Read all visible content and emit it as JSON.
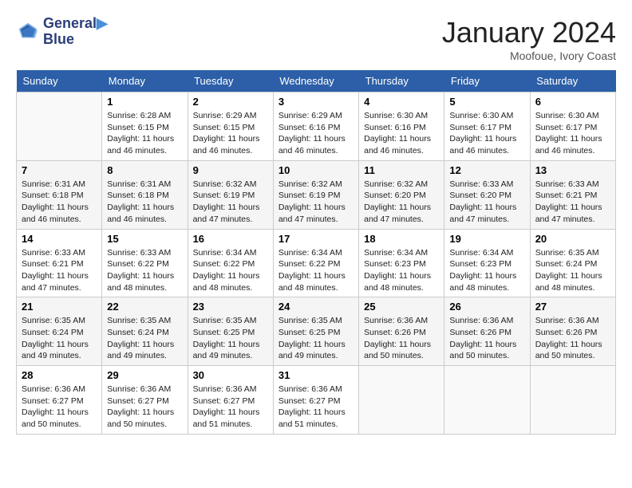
{
  "header": {
    "logo_line1": "General",
    "logo_line2": "Blue",
    "month_title": "January 2024",
    "subtitle": "Moofoue, Ivory Coast"
  },
  "weekdays": [
    "Sunday",
    "Monday",
    "Tuesday",
    "Wednesday",
    "Thursday",
    "Friday",
    "Saturday"
  ],
  "weeks": [
    [
      {
        "day": "",
        "sunrise": "",
        "sunset": "",
        "daylight": ""
      },
      {
        "day": "1",
        "sunrise": "6:28 AM",
        "sunset": "6:15 PM",
        "daylight": "11 hours and 46 minutes."
      },
      {
        "day": "2",
        "sunrise": "6:29 AM",
        "sunset": "6:15 PM",
        "daylight": "11 hours and 46 minutes."
      },
      {
        "day": "3",
        "sunrise": "6:29 AM",
        "sunset": "6:16 PM",
        "daylight": "11 hours and 46 minutes."
      },
      {
        "day": "4",
        "sunrise": "6:30 AM",
        "sunset": "6:16 PM",
        "daylight": "11 hours and 46 minutes."
      },
      {
        "day": "5",
        "sunrise": "6:30 AM",
        "sunset": "6:17 PM",
        "daylight": "11 hours and 46 minutes."
      },
      {
        "day": "6",
        "sunrise": "6:30 AM",
        "sunset": "6:17 PM",
        "daylight": "11 hours and 46 minutes."
      }
    ],
    [
      {
        "day": "7",
        "sunrise": "6:31 AM",
        "sunset": "6:18 PM",
        "daylight": "11 hours and 46 minutes."
      },
      {
        "day": "8",
        "sunrise": "6:31 AM",
        "sunset": "6:18 PM",
        "daylight": "11 hours and 46 minutes."
      },
      {
        "day": "9",
        "sunrise": "6:32 AM",
        "sunset": "6:19 PM",
        "daylight": "11 hours and 47 minutes."
      },
      {
        "day": "10",
        "sunrise": "6:32 AM",
        "sunset": "6:19 PM",
        "daylight": "11 hours and 47 minutes."
      },
      {
        "day": "11",
        "sunrise": "6:32 AM",
        "sunset": "6:20 PM",
        "daylight": "11 hours and 47 minutes."
      },
      {
        "day": "12",
        "sunrise": "6:33 AM",
        "sunset": "6:20 PM",
        "daylight": "11 hours and 47 minutes."
      },
      {
        "day": "13",
        "sunrise": "6:33 AM",
        "sunset": "6:21 PM",
        "daylight": "11 hours and 47 minutes."
      }
    ],
    [
      {
        "day": "14",
        "sunrise": "6:33 AM",
        "sunset": "6:21 PM",
        "daylight": "11 hours and 47 minutes."
      },
      {
        "day": "15",
        "sunrise": "6:33 AM",
        "sunset": "6:22 PM",
        "daylight": "11 hours and 48 minutes."
      },
      {
        "day": "16",
        "sunrise": "6:34 AM",
        "sunset": "6:22 PM",
        "daylight": "11 hours and 48 minutes."
      },
      {
        "day": "17",
        "sunrise": "6:34 AM",
        "sunset": "6:22 PM",
        "daylight": "11 hours and 48 minutes."
      },
      {
        "day": "18",
        "sunrise": "6:34 AM",
        "sunset": "6:23 PM",
        "daylight": "11 hours and 48 minutes."
      },
      {
        "day": "19",
        "sunrise": "6:34 AM",
        "sunset": "6:23 PM",
        "daylight": "11 hours and 48 minutes."
      },
      {
        "day": "20",
        "sunrise": "6:35 AM",
        "sunset": "6:24 PM",
        "daylight": "11 hours and 48 minutes."
      }
    ],
    [
      {
        "day": "21",
        "sunrise": "6:35 AM",
        "sunset": "6:24 PM",
        "daylight": "11 hours and 49 minutes."
      },
      {
        "day": "22",
        "sunrise": "6:35 AM",
        "sunset": "6:24 PM",
        "daylight": "11 hours and 49 minutes."
      },
      {
        "day": "23",
        "sunrise": "6:35 AM",
        "sunset": "6:25 PM",
        "daylight": "11 hours and 49 minutes."
      },
      {
        "day": "24",
        "sunrise": "6:35 AM",
        "sunset": "6:25 PM",
        "daylight": "11 hours and 49 minutes."
      },
      {
        "day": "25",
        "sunrise": "6:36 AM",
        "sunset": "6:26 PM",
        "daylight": "11 hours and 50 minutes."
      },
      {
        "day": "26",
        "sunrise": "6:36 AM",
        "sunset": "6:26 PM",
        "daylight": "11 hours and 50 minutes."
      },
      {
        "day": "27",
        "sunrise": "6:36 AM",
        "sunset": "6:26 PM",
        "daylight": "11 hours and 50 minutes."
      }
    ],
    [
      {
        "day": "28",
        "sunrise": "6:36 AM",
        "sunset": "6:27 PM",
        "daylight": "11 hours and 50 minutes."
      },
      {
        "day": "29",
        "sunrise": "6:36 AM",
        "sunset": "6:27 PM",
        "daylight": "11 hours and 50 minutes."
      },
      {
        "day": "30",
        "sunrise": "6:36 AM",
        "sunset": "6:27 PM",
        "daylight": "11 hours and 51 minutes."
      },
      {
        "day": "31",
        "sunrise": "6:36 AM",
        "sunset": "6:27 PM",
        "daylight": "11 hours and 51 minutes."
      },
      {
        "day": "",
        "sunrise": "",
        "sunset": "",
        "daylight": ""
      },
      {
        "day": "",
        "sunrise": "",
        "sunset": "",
        "daylight": ""
      },
      {
        "day": "",
        "sunrise": "",
        "sunset": "",
        "daylight": ""
      }
    ]
  ],
  "labels": {
    "sunrise": "Sunrise:",
    "sunset": "Sunset:",
    "daylight": "Daylight:"
  }
}
